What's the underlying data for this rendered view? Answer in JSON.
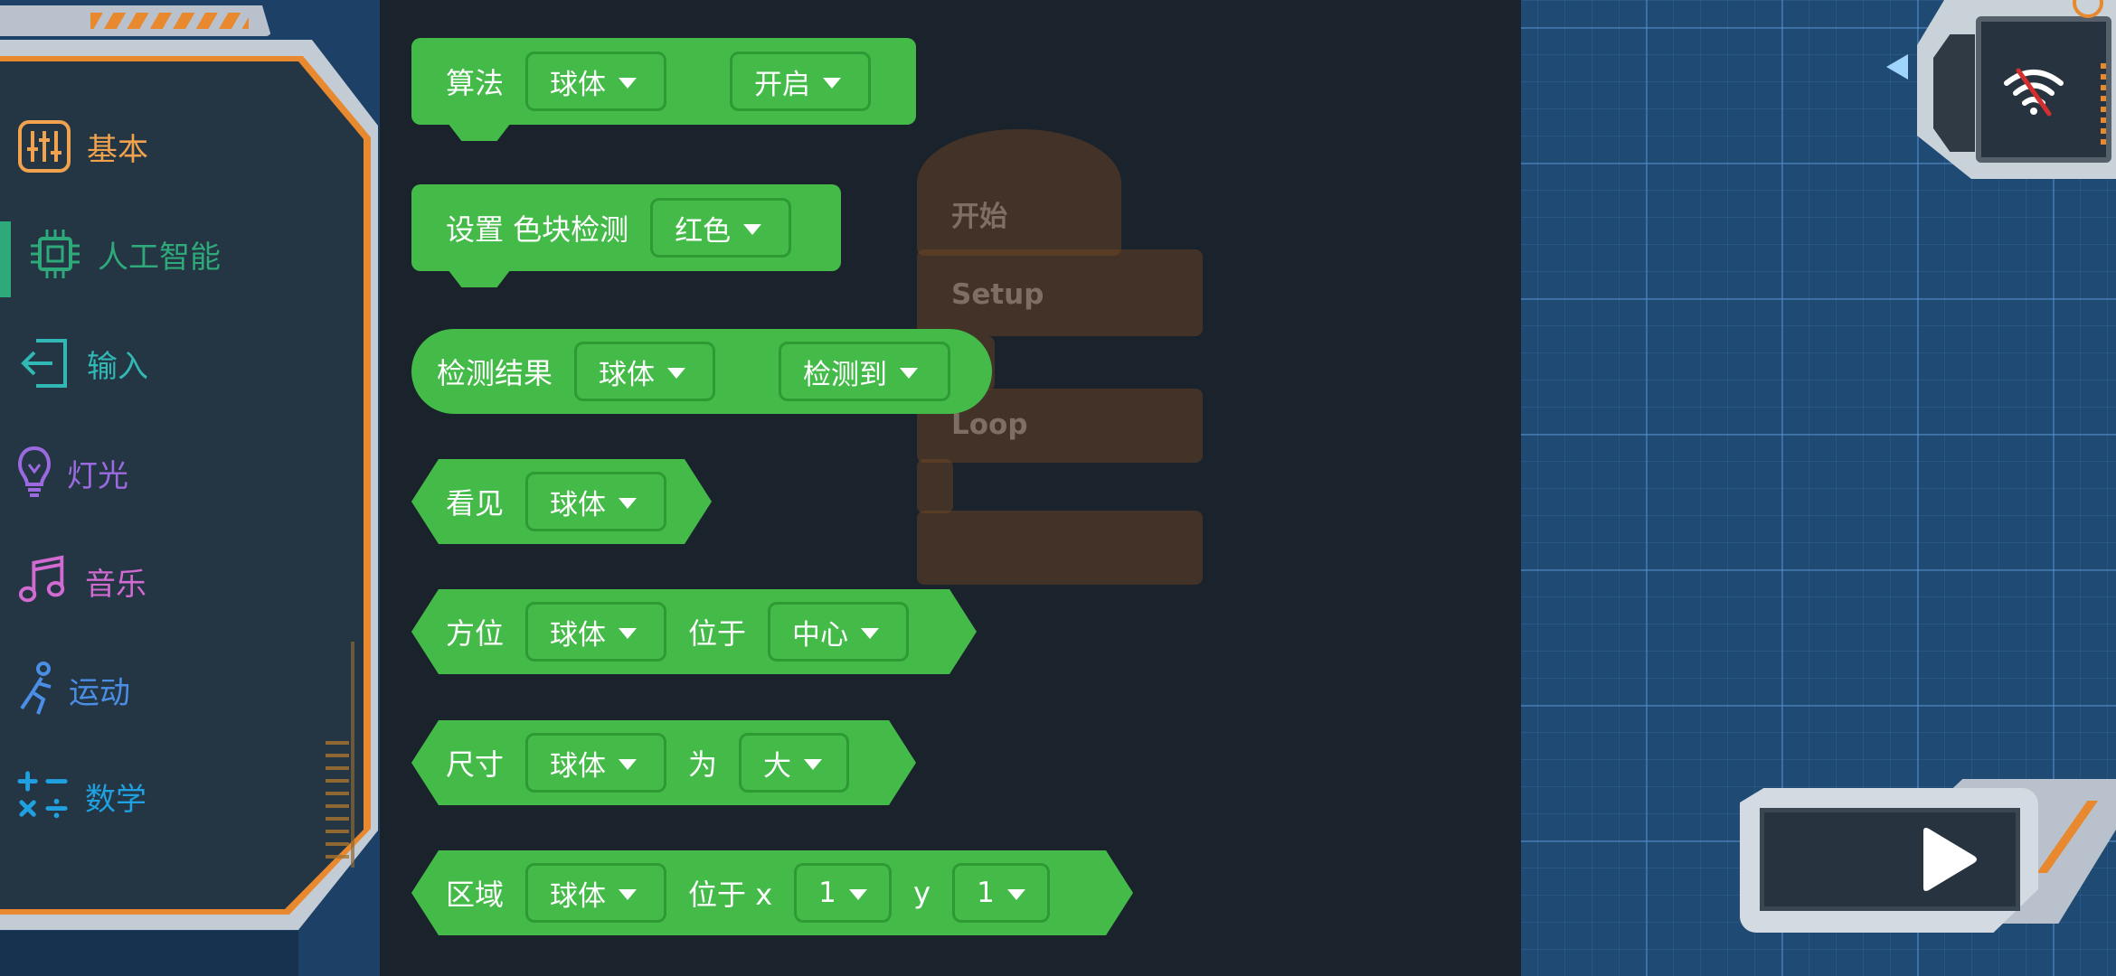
{
  "categories": [
    {
      "id": "basic",
      "label": "基本",
      "color": "#f0a24e",
      "icon": "sliders-icon"
    },
    {
      "id": "ai",
      "label": "人工智能",
      "color": "#2ea97a",
      "icon": "chip-icon",
      "active": true
    },
    {
      "id": "input",
      "label": "输入",
      "color": "#32b8b4",
      "icon": "sign-in-icon"
    },
    {
      "id": "light",
      "label": "灯光",
      "color": "#9b6ae0",
      "icon": "lightbulb-icon"
    },
    {
      "id": "music",
      "label": "音乐",
      "color": "#d16ad1",
      "icon": "music-note-icon"
    },
    {
      "id": "motion",
      "label": "运动",
      "color": "#4a8ee6",
      "icon": "running-person-icon"
    },
    {
      "id": "math",
      "label": "数学",
      "color": "#1fa0e0",
      "icon": "math-operators-icon"
    }
  ],
  "ghost_block": {
    "start": "开始",
    "setup": "Setup",
    "loop": "Loop"
  },
  "blocks": {
    "algorithm": {
      "label": "算法",
      "object": "球体",
      "state": "开启"
    },
    "color_detect": {
      "label": "设置 色块检测",
      "color": "红色"
    },
    "detect_result": {
      "label": "检测结果",
      "object": "球体",
      "result": "检测到"
    },
    "see": {
      "label": "看见",
      "object": "球体"
    },
    "position": {
      "label": "方位",
      "object": "球体",
      "at": "位于",
      "place": "中心"
    },
    "size": {
      "label": "尺寸",
      "object": "球体",
      "is": "为",
      "value": "大"
    },
    "region": {
      "label": "区域",
      "object": "球体",
      "at": "位于 x",
      "x": "1",
      "y_label": "y",
      "y": "1"
    }
  },
  "colors": {
    "block_green": "#44bb49",
    "palette_bg": "#1a222b",
    "workspace_bg": "#1f4a73",
    "accent_orange": "#e8892f"
  }
}
